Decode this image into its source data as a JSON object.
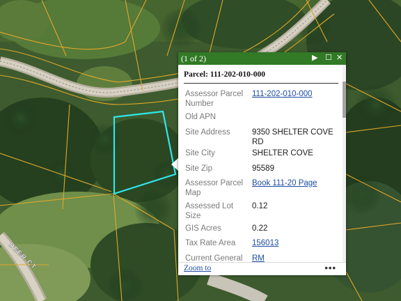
{
  "map": {
    "street_label": "DEER CT",
    "colors": {
      "parcel_line": "#e2a82a",
      "selected_parcel": "#2fe6ea",
      "road": "#c8c2b4",
      "titlebar": "#327a26",
      "link": "#1e4da0"
    }
  },
  "popup": {
    "count_label": "(1 of 2)",
    "controls": {
      "next_icon": "play-triangle",
      "maximize_icon": "square-outline",
      "close_icon": "x",
      "next_symbol": "▶",
      "maximize_symbol": "☐",
      "close_symbol": "✕"
    },
    "heading": "Parcel: 111-202-010-000",
    "rows": [
      {
        "label": "Assessor Parcel Number",
        "value": "111-202-010-000",
        "link": true
      },
      {
        "label": "Old APN",
        "value": "",
        "link": false
      },
      {
        "label": "Site Address",
        "value": "9350 SHELTER COVE RD",
        "link": false
      },
      {
        "label": "Site City",
        "value": "SHELTER COVE",
        "link": false
      },
      {
        "label": "Site Zip",
        "value": "95589",
        "link": false
      },
      {
        "label": "Assessor Parcel Map",
        "value": "Book 111-20 Page",
        "link": true
      },
      {
        "label": "Assessed Lot Size",
        "value": "0.12",
        "link": false
      },
      {
        "label": "GIS Acres",
        "value": "0.22",
        "link": false
      },
      {
        "label": "Tax Rate Area",
        "value": "156013",
        "link": true
      },
      {
        "label": "Current General",
        "value": "RM",
        "link": true
      }
    ],
    "footer": {
      "zoom_label": "Zoom to",
      "more_label": "•••"
    }
  }
}
